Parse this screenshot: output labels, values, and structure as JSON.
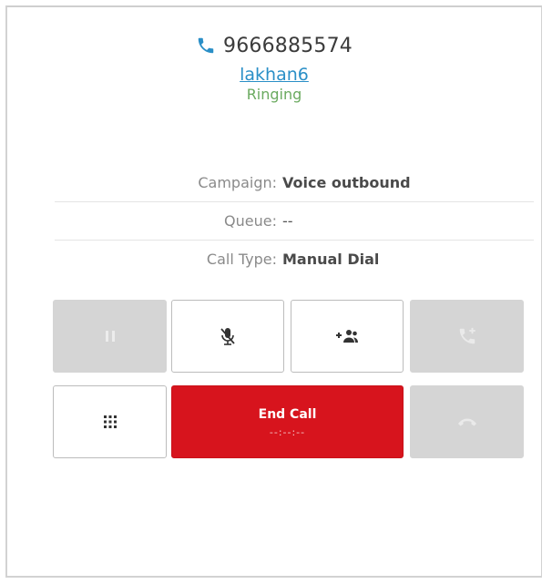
{
  "call": {
    "phone_number": "9666885574",
    "contact_name": "lakhan6",
    "status": "Ringing"
  },
  "details": {
    "campaign_label": "Campaign:",
    "campaign_value": "Voice outbound",
    "queue_label": "Queue:",
    "queue_value": "--",
    "call_type_label": "Call Type:",
    "call_type_value": "Manual Dial"
  },
  "controls": {
    "end_call_label": "End Call",
    "end_call_timer": "--:--:--",
    "icons": [
      "hold-icon",
      "mute-microphone-icon",
      "add-participant-icon",
      "transfer-call-icon",
      "dialpad-icon",
      "hangup-icon"
    ]
  },
  "colors": {
    "accent": "#2a8fc7",
    "status_green": "#6aaa5f",
    "end_call_red": "#d7141d",
    "disabled_gray": "#d5d5d5"
  }
}
